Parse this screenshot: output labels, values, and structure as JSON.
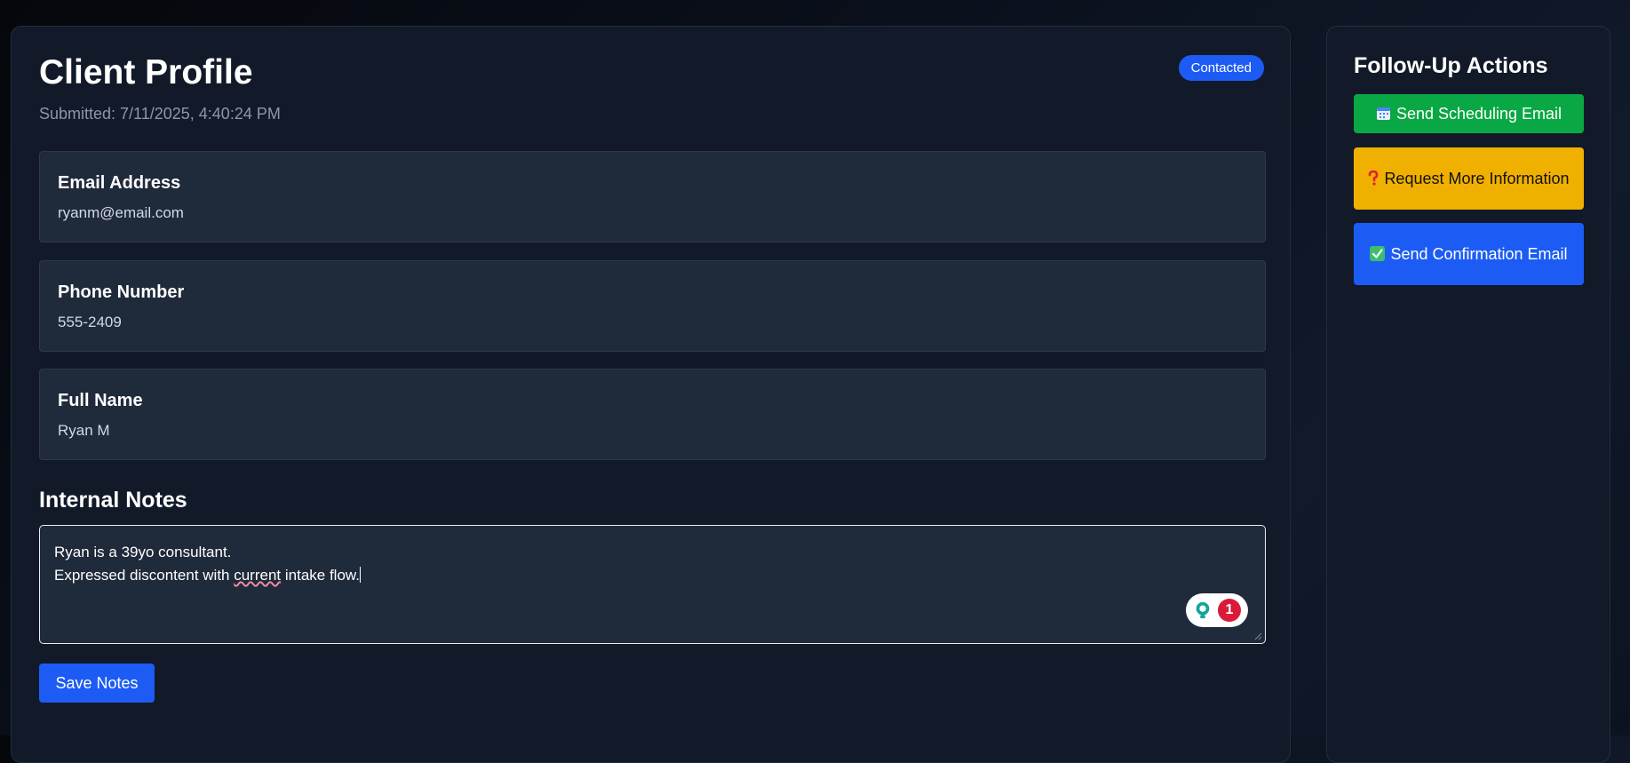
{
  "profile": {
    "title": "Client Profile",
    "submitted": "Submitted: 7/11/2025, 4:40:24 PM",
    "status": "Contacted",
    "status_color": "#1c5cf5",
    "fields": [
      {
        "label": "Email Address",
        "value": "ryanm@email.com"
      },
      {
        "label": "Phone Number",
        "value": "555-2409"
      },
      {
        "label": "Full Name",
        "value": "Ryan M"
      }
    ]
  },
  "notes": {
    "heading": "Internal Notes",
    "line1": "Ryan is a 39yo consultant.",
    "line2_before": "Expressed discontent with ",
    "line2_flagged": "current",
    "line2_after": " intake flow.",
    "grammar_issue_count": "1",
    "save_label": "Save Notes"
  },
  "followup": {
    "title": "Follow-Up Actions",
    "actions": [
      {
        "icon": "calendar-icon",
        "label": "Send Scheduling Email",
        "color": "#0aa845"
      },
      {
        "icon": "question-mark-icon",
        "label": "Request More Information",
        "color": "#f0b000"
      },
      {
        "icon": "checkmark-icon",
        "label": "Send Confirmation Email",
        "color": "#1c5cf5"
      }
    ]
  }
}
